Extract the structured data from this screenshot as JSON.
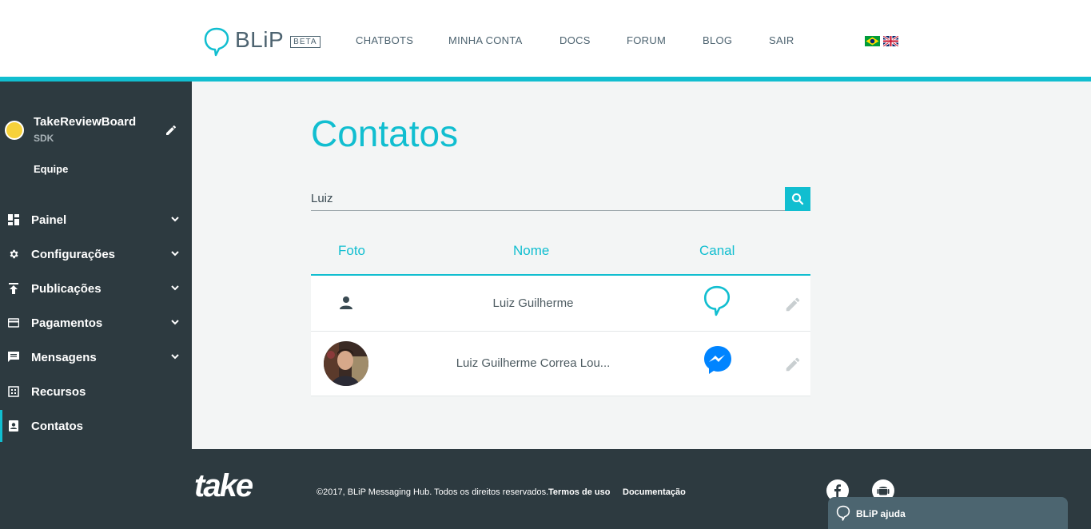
{
  "brand": {
    "logo": "BLiP",
    "beta": "BETA"
  },
  "nav": [
    "CHATBOTS",
    "MINHA CONTA",
    "DOCS",
    "FORUM",
    "BLOG",
    "SAIR"
  ],
  "sidebar": {
    "bot_name": "TakeReviewBoard",
    "bot_type": "SDK",
    "team": "Equipe",
    "items": [
      {
        "label": "Painel",
        "icon": "dashboard-icon",
        "expandable": true
      },
      {
        "label": "Configurações",
        "icon": "gear-icon",
        "expandable": true
      },
      {
        "label": "Publicações",
        "icon": "publish-icon",
        "expandable": true
      },
      {
        "label": "Pagamentos",
        "icon": "credit-card-icon",
        "expandable": true
      },
      {
        "label": "Mensagens",
        "icon": "message-icon",
        "expandable": true
      },
      {
        "label": "Recursos",
        "icon": "resources-icon",
        "expandable": false
      },
      {
        "label": "Contatos",
        "icon": "contacts-icon",
        "expandable": false,
        "active": true
      }
    ]
  },
  "main": {
    "title": "Contatos",
    "search": {
      "value": "Luiz",
      "placeholder": ""
    },
    "table": {
      "headers": {
        "photo": "Foto",
        "name": "Nome",
        "channel": "Canal"
      },
      "rows": [
        {
          "name": "Luiz Guilherme",
          "photo": "default-user-icon",
          "channel": "blip-icon"
        },
        {
          "name": "Luiz Guilherme Correa Lou...",
          "photo": "user-photo",
          "channel": "messenger-icon"
        }
      ]
    }
  },
  "footer": {
    "logo": "take",
    "copyright": "©2017, BLiP Messaging Hub. Todos os direitos reservados.",
    "links": [
      "Termos de uso",
      "Documentação"
    ],
    "help_label": "BLiP ajuda"
  },
  "colors": {
    "accent": "#11bed0",
    "sidebar": "#2d3a40",
    "messenger": "#0084ff"
  }
}
